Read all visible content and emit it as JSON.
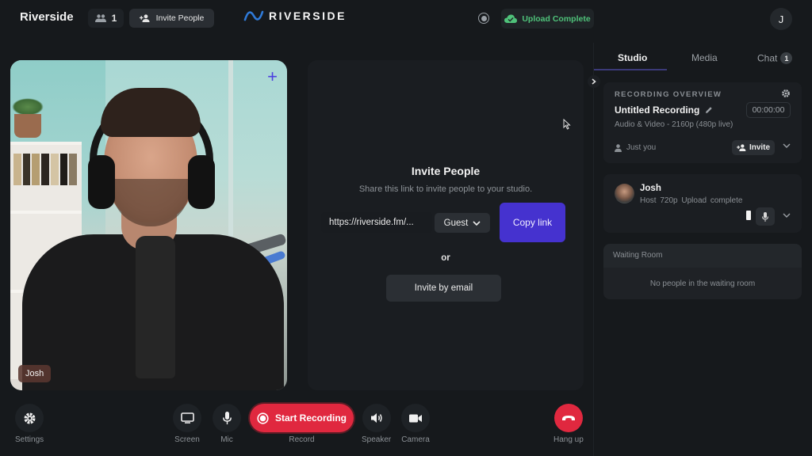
{
  "header": {
    "app_title": "Riverside",
    "people_count": "1",
    "invite_people_label": "Invite People",
    "logo_text": "RIVERSIDE",
    "upload_status": "Upload Complete",
    "user_initial": "J"
  },
  "video_tile": {
    "participant_name": "Josh",
    "add_icon": "+"
  },
  "invite_panel": {
    "title": "Invite People",
    "subtitle": "Share this link to invite people to your studio.",
    "link_value": "https://riverside.fm/...",
    "role_selected": "Guest",
    "copy_label": "Copy link",
    "or_label": "or",
    "invite_email_label": "Invite by email"
  },
  "sidebar": {
    "tabs": [
      {
        "label": "Studio",
        "active": true
      },
      {
        "label": "Media",
        "active": false
      },
      {
        "label": "Chat",
        "active": false,
        "badge": "1"
      }
    ],
    "recording_overview": {
      "section_label": "RECORDING OVERVIEW",
      "title": "Untitled Recording",
      "timer": "00:00:00",
      "quality": "Audio & Video - 2160p (480p live)",
      "participants": "Just you",
      "invite_label": "Invite"
    },
    "host": {
      "name": "Josh",
      "role": "Host",
      "resolution": "720p",
      "status": "Upload complete"
    },
    "waiting_room": {
      "title": "Waiting Room",
      "empty_text": "No people in the waiting room"
    }
  },
  "controls": {
    "settings": "Settings",
    "screen": "Screen",
    "mic": "Mic",
    "record_button": "Start Recording",
    "record_label": "Record",
    "speaker": "Speaker",
    "camera": "Camera",
    "hang_up": "Hang up"
  },
  "colors": {
    "accent": "#4532cf",
    "record_red": "#e0283f",
    "success_green": "#4fc27a",
    "background": "#16191c"
  }
}
